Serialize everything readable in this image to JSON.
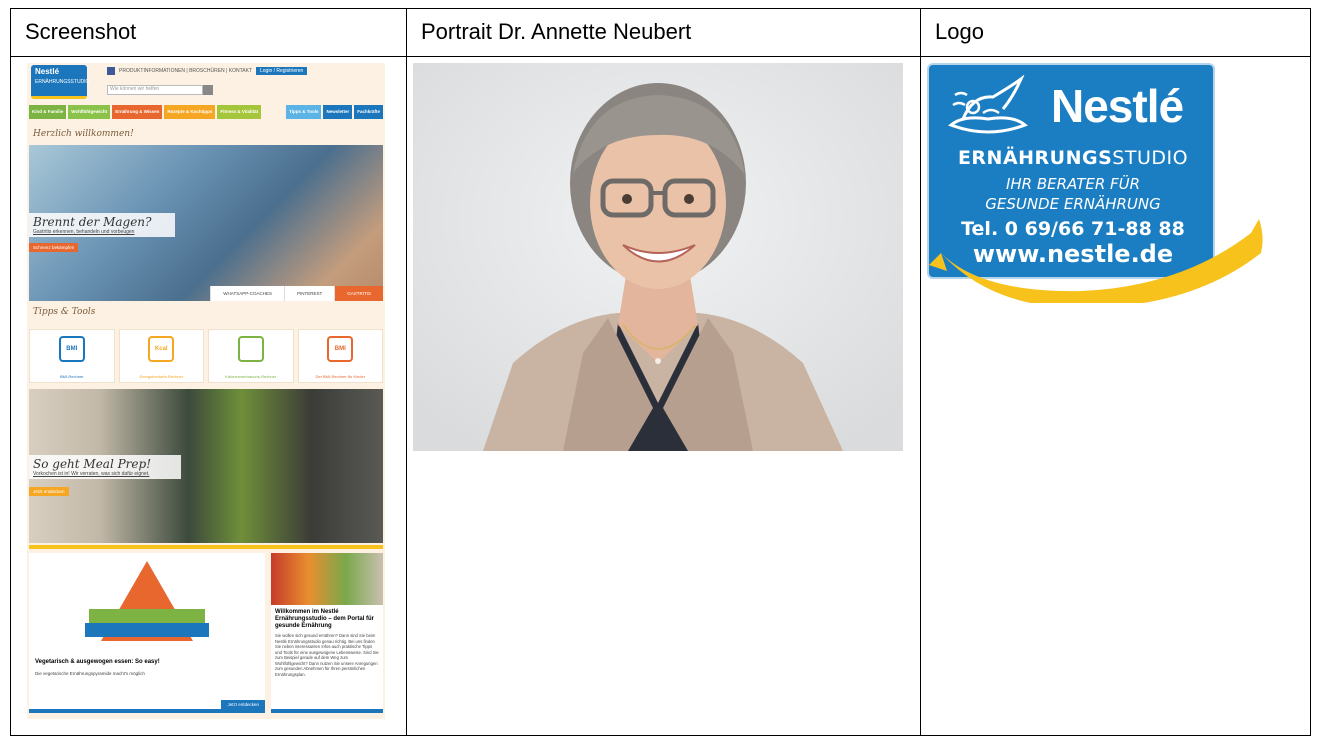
{
  "headers": {
    "col1": "Screenshot",
    "col2": "Portrait Dr. Annette Neubert",
    "col3": "Logo"
  },
  "screenshot": {
    "top_links": "PRODUKTINFORMATIONEN  |  BROSCHÜREN  |  KONTAKT",
    "login_label": "Login / Registrieren",
    "search_placeholder": "Wie können wir helfen",
    "nav": [
      {
        "label": "Kind & Familie",
        "color": "#7cb342"
      },
      {
        "label": "Wohlfühlgewicht",
        "color": "#8bc34a"
      },
      {
        "label": "Ernährung & Wissen",
        "color": "#e8672e"
      },
      {
        "label": "Rezepte & Kochtipps",
        "color": "#f5a623"
      },
      {
        "label": "Fitness & Vitalität",
        "color": "#a5c63b"
      },
      {
        "label": "Tipps & Tools",
        "color": "#5cb3e5"
      },
      {
        "label": "Newsletter",
        "color": "#1b76bc"
      },
      {
        "label": "Fachkräfte",
        "color": "#1b76bc"
      }
    ],
    "welcome": "Herzlich willkommen!",
    "hero1_title": "Brennt der Magen?",
    "hero1_sub": "Gastritis erkennen, behandeln und vorbeugen",
    "hero1_btn": "Schmerz bekämpfen",
    "hero1_tabs": [
      "WHATSAPP-COACHES",
      "PINTEREST",
      "GASTRITIS"
    ],
    "tools_heading": "Tipps & Tools",
    "tools": [
      {
        "icon_text": "BMI",
        "label": "BMI-Rechner",
        "color": "#1b76bc"
      },
      {
        "icon_text": "Kcal",
        "label": "Energiebedarfs-Rechner",
        "color": "#f5a623"
      },
      {
        "icon_text": "",
        "label": "Kalorienverbrauchs-Rechner",
        "color": "#7cb342"
      },
      {
        "icon_text": "BMI",
        "label": "Der BMI-Rechner für Kinder",
        "color": "#e8672e"
      }
    ],
    "hero2_title": "So geht Meal Prep!",
    "hero2_sub": "Vorkochen ist in! Wir verraten, was sich dafür eignet.",
    "hero2_btn": "Jetzt entdecken",
    "pyramid_title": "Vegetarisch & ausgewogen essen: So easy!",
    "pyramid_sub": "Die vegetarische Ernährungspyramide macht's möglich",
    "pyramid_btn": "Jetzt entdecken",
    "portal_title": "Willkommen im Nestlé Ernährungsstudio – dem Portal für gesunde Ernährung",
    "portal_text": "Sie wollen sich gesund ernähren? Dann sind Sie beim Nestlé Ernährungsstudio genau richtig. Bei uns finden Sie neben interessanten Infos auch praktische Tipps und Tools für eine ausgewogene Lebensweise. Sind Sie zum Beispiel gerade auf dem Weg zum Wohlfühlgewicht? Dann nutzen Sie unsere Anregungen zum gesunden Abnehmen für Ihren persönlichen Ernährungsplan."
  },
  "logo": {
    "brand": "Nestlé",
    "studio_bold": "ERNÄHRUNGS",
    "studio_light": "STUDIO",
    "line1": "IHR BERATER FÜR",
    "line2": "GESUNDE ERNÄHRUNG",
    "tel": "Tel. 0 69/66 71-88 88",
    "web": "www.nestle.de",
    "blue": "#1b7ec2",
    "yellow": "#f7c21c"
  }
}
